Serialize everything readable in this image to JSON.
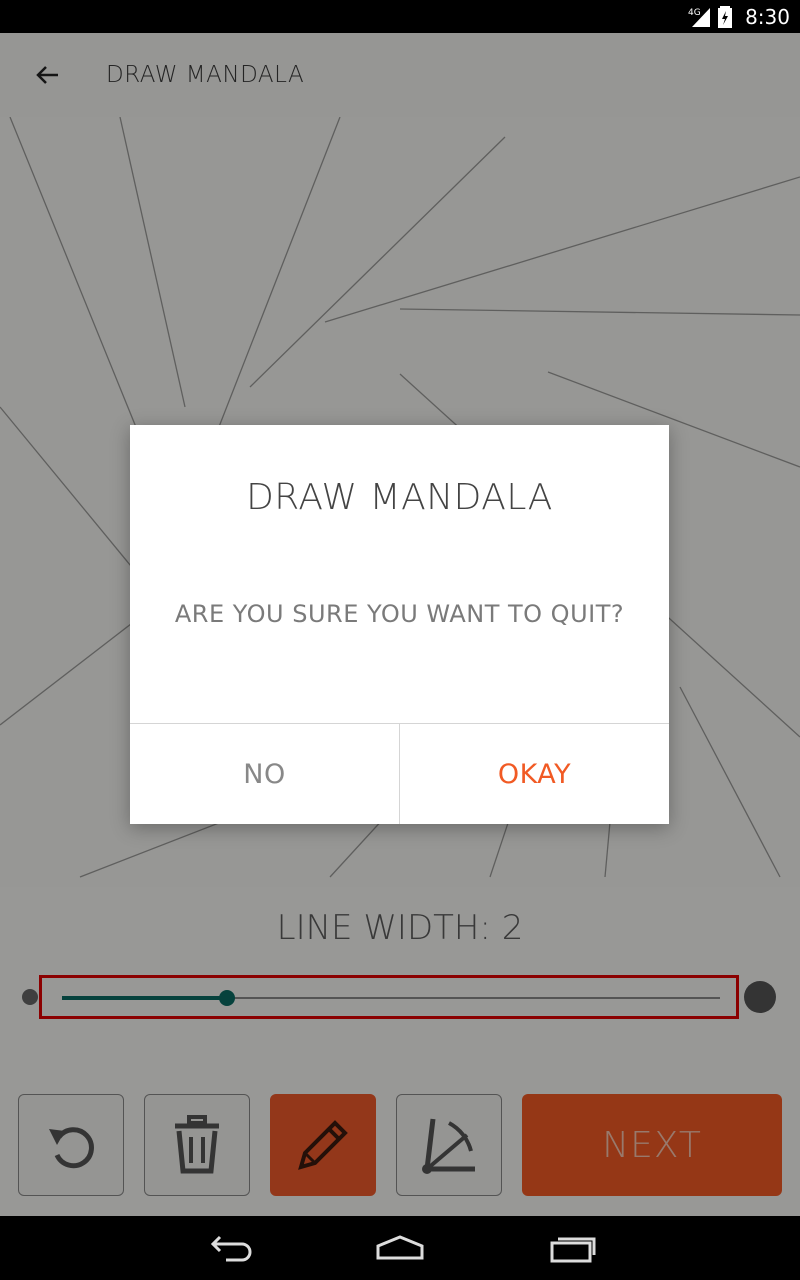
{
  "status_bar": {
    "time": "8:30",
    "network": "4G",
    "icons": [
      "signal-icon",
      "battery-icon"
    ]
  },
  "toolbar": {
    "title": "DRAW MANDALA",
    "back_icon": "arrow-left-icon"
  },
  "line_width": {
    "label": "LINE WIDTH: 2",
    "slider_fraction": 0.25
  },
  "tools": [
    {
      "name": "undo-button",
      "icon": "undo-icon"
    },
    {
      "name": "delete-button",
      "icon": "trash-icon"
    },
    {
      "name": "draw-button",
      "icon": "pencil-icon",
      "active": true
    },
    {
      "name": "symmetry-button",
      "icon": "angle-icon"
    }
  ],
  "next_label": "NEXT",
  "dialog": {
    "title": "DRAW MANDALA",
    "message": "ARE YOU SURE YOU WANT TO QUIT?",
    "no_label": "NO",
    "okay_label": "OKAY"
  },
  "colors": {
    "accent": "#f15a24",
    "slider": "#0a6b63"
  },
  "nav_bar": [
    "back-nav-icon",
    "home-nav-icon",
    "recents-nav-icon"
  ]
}
